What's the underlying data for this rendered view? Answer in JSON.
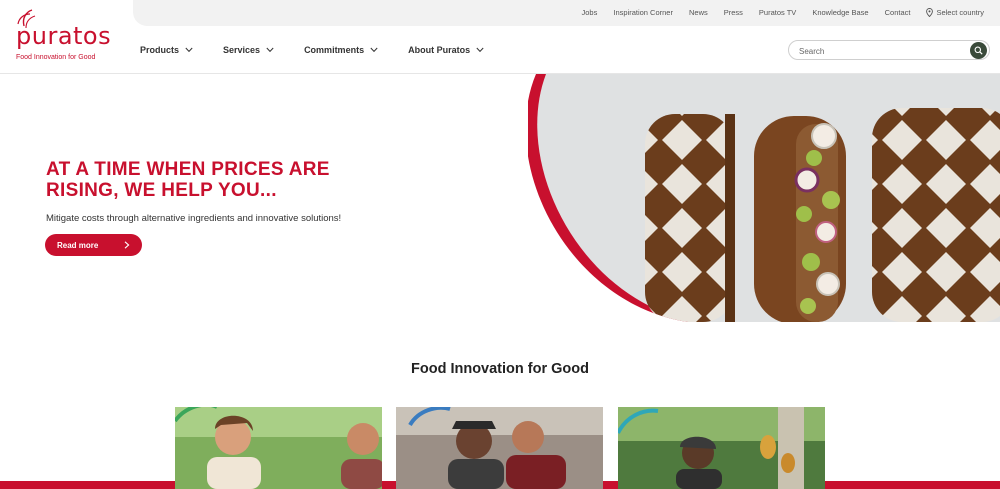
{
  "brand": {
    "name": "puratos",
    "tagline": "Food Innovation for Good",
    "color": "#c8102e"
  },
  "topbar": {
    "links": [
      "Jobs",
      "Inspiration Corner",
      "News",
      "Press",
      "Puratos TV",
      "Knowledge Base",
      "Contact"
    ],
    "country_label": "Select country"
  },
  "nav": {
    "items": [
      "Products",
      "Services",
      "Commitments",
      "About Puratos"
    ]
  },
  "search": {
    "placeholder": "Search"
  },
  "hero": {
    "title": "AT A TIME WHEN PRICES ARE RISING, WE HELP YOU...",
    "subtitle": "Mitigate costs through alternative ingredients and innovative solutions!",
    "button_label": "Read more"
  },
  "section": {
    "title": "Food Innovation for Good"
  },
  "icons": {
    "search": "search-icon",
    "location": "map-pin-icon",
    "chevron": "chevron-down-icon",
    "arrow": "chevron-right-icon"
  }
}
